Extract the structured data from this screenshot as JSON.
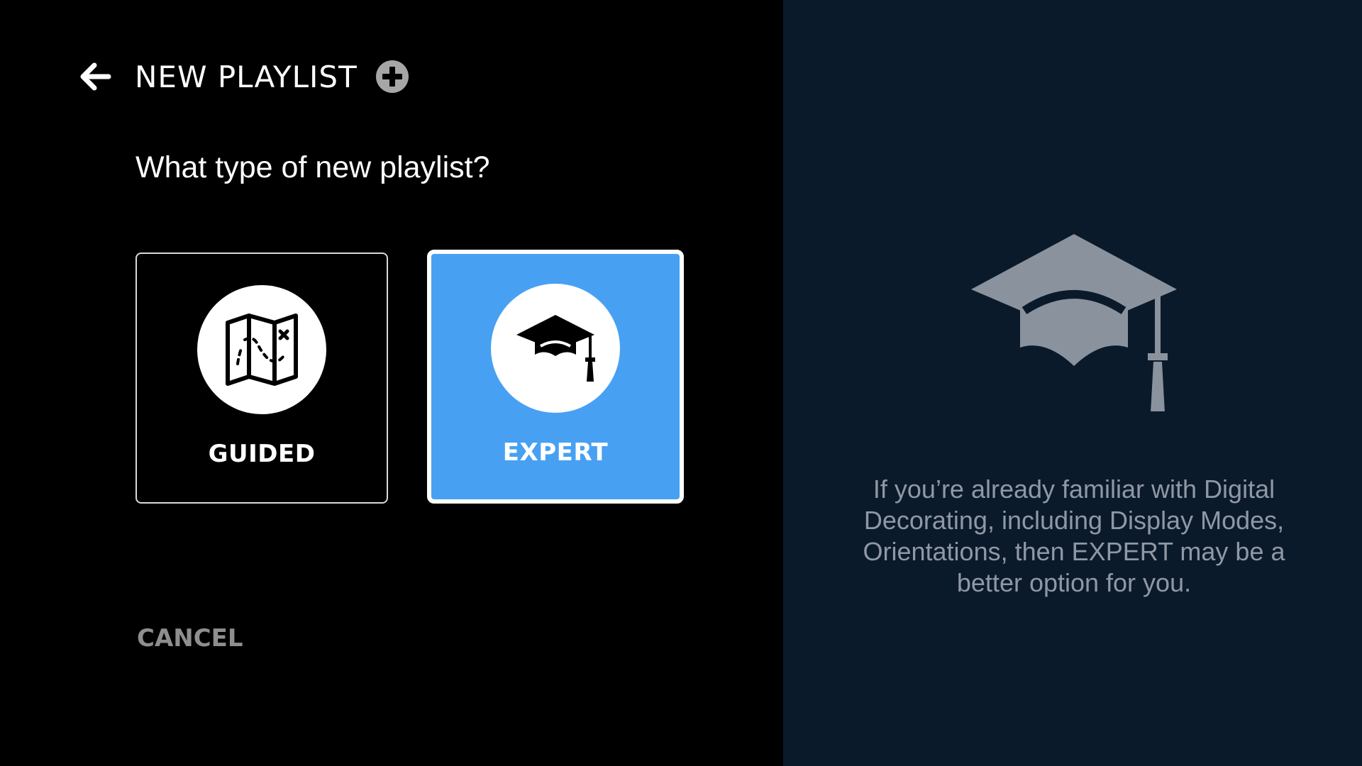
{
  "header": {
    "title": "NEW PLAYLIST",
    "back_icon": "arrow-left-icon",
    "add_icon": "plus-circle-icon"
  },
  "question": "What type of new playlist?",
  "options": [
    {
      "label": "GUIDED",
      "icon": "map-icon",
      "selected": false
    },
    {
      "label": "EXPERT",
      "icon": "graduation-cap-icon",
      "selected": true
    }
  ],
  "cancel_label": "CANCEL",
  "info_panel": {
    "icon": "graduation-cap-icon",
    "description": "If you’re already familiar with Digital Decorating, including Display Modes, Orientations, then EXPERT may be a better option for you."
  },
  "colors": {
    "selected_card": "#48a0f3",
    "info_panel_bg": "#0b1a2b",
    "info_text": "#8f98a4",
    "cancel_text": "#8e8e8e"
  }
}
